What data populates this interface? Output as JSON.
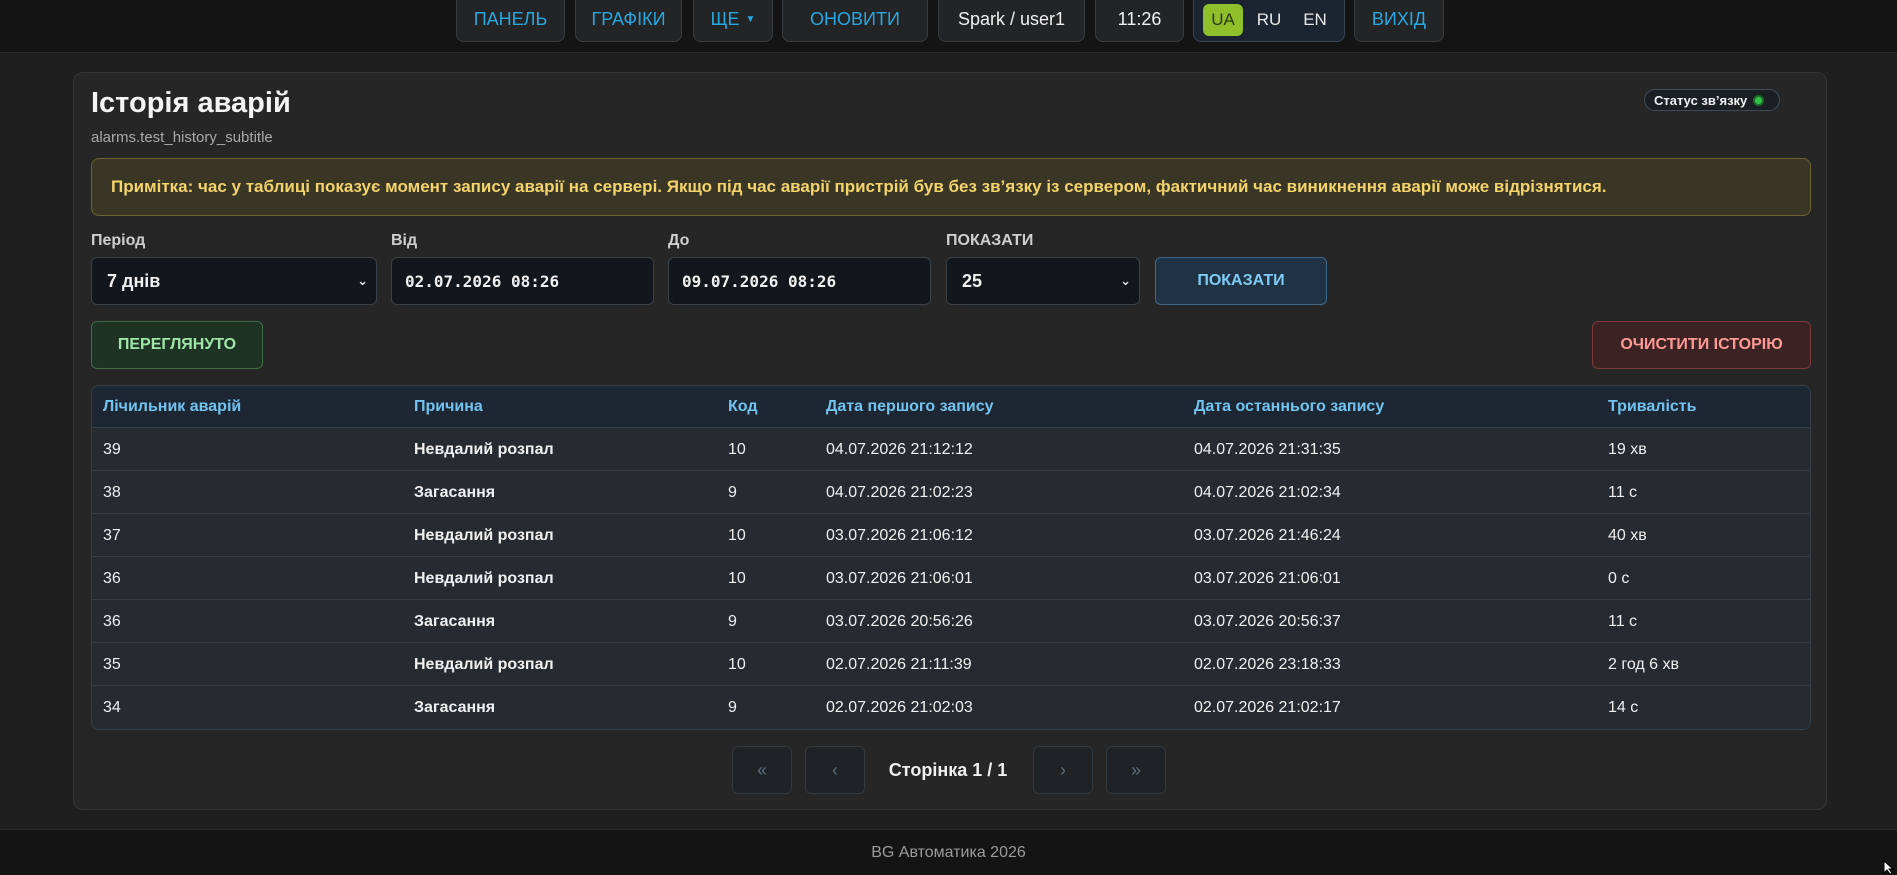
{
  "nav": {
    "panel": "ПАНЕЛЬ",
    "charts": "ГРАФІКИ",
    "more": "ЩЕ",
    "refresh": "ОНОВИТИ",
    "user": "Spark / user1",
    "time": "11:26",
    "langs": [
      "UA",
      "RU",
      "EN"
    ],
    "active_lang": "UA",
    "logout": "ВИХІД"
  },
  "page": {
    "title": "Історія аварій",
    "subtitle": "alarms.test_history_subtitle",
    "status_label": "Статус зв’язку",
    "note": "Примітка: час у таблиці показує момент запису аварії на сервері. Якщо під час аварії пристрій був без зв’язку із сервером, фактичний час виникнення аварії може відрізнятися."
  },
  "filters": {
    "period_label": "Період",
    "period_value": "7 днів",
    "from_label": "Від",
    "from_value": "02.07.2026 08:26",
    "to_label": "До",
    "to_value": "09.07.2026 08:26",
    "show_label": "ПОКАЗАТИ",
    "show_value": "25",
    "show_button": "ПОКАЗАТИ"
  },
  "actions": {
    "seen": "ПЕРЕГЛЯНУТО",
    "clear": "ОЧИСТИТИ ІСТОРІЮ"
  },
  "table": {
    "headers": [
      "Лічильник аварій",
      "Причина",
      "Код",
      "Дата першого запису",
      "Дата останнього запису",
      "Тривалість"
    ],
    "rows": [
      [
        "39",
        "Невдалий розпал",
        "10",
        "04.07.2026 21:12:12",
        "04.07.2026 21:31:35",
        "19 хв"
      ],
      [
        "38",
        "Загасання",
        "9",
        "04.07.2026 21:02:23",
        "04.07.2026 21:02:34",
        "11 с"
      ],
      [
        "37",
        "Невдалий розпал",
        "10",
        "03.07.2026 21:06:12",
        "03.07.2026 21:46:24",
        "40 хв"
      ],
      [
        "36",
        "Невдалий розпал",
        "10",
        "03.07.2026 21:06:01",
        "03.07.2026 21:06:01",
        "0 с"
      ],
      [
        "36",
        "Загасання",
        "9",
        "03.07.2026 20:56:26",
        "03.07.2026 20:56:37",
        "11 с"
      ],
      [
        "35",
        "Невдалий розпал",
        "10",
        "02.07.2026 21:11:39",
        "02.07.2026 23:18:33",
        "2 год 6 хв"
      ],
      [
        "34",
        "Загасання",
        "9",
        "02.07.2026 21:02:03",
        "02.07.2026 21:02:17",
        "14 с"
      ]
    ]
  },
  "pagination": {
    "first": "«",
    "prev": "‹",
    "info": "Сторінка 1 / 1",
    "next": "›",
    "last": "»"
  },
  "footer": "BG Автоматика 2026"
}
